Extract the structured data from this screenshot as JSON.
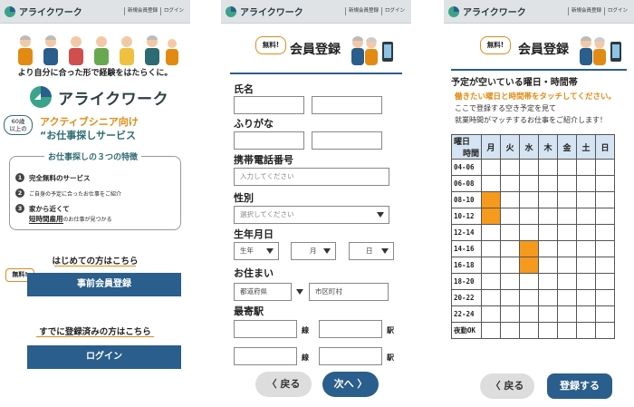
{
  "brand": {
    "name": "アライクワーク",
    "accent": "#2a5e8c",
    "orange": "#e38a12",
    "teal": "#2d6b73"
  },
  "header": {
    "register": "新規会員登録",
    "login": "ログイン"
  },
  "screen1": {
    "tagline": "より自分に合った形で経験をはたらくに。",
    "brand_big": "アライクワーク",
    "age_badge": [
      "60歳",
      "以上の"
    ],
    "subtitle_1": "アクティブシニア向け",
    "subtitle_2": "“お仕事探しサービス",
    "features_title": "お仕事探しの３つの特徴",
    "feature_1": "完全無料のサービス",
    "feature_2a": "ご自身の予定に合った",
    "feature_2b": "お仕事をご紹介",
    "feature_3a": "家から近くて",
    "feature_3b": "短時間雇用",
    "feature_3c": "のお仕事が見つかる",
    "first_time": "はじめての方はこちら",
    "free_badge": "無料!",
    "pre_register": "事前会員登録",
    "already": "すでに登録済みの方はこちら",
    "login_button": "ログイン"
  },
  "screen2": {
    "free": "無料!",
    "title": "会員登録",
    "name_label": "氏名",
    "furigana_label": "ふりがな",
    "phone_label": "携帯電話番号",
    "phone_placeholder": "入力してください",
    "gender_label": "性別",
    "gender_placeholder": "選択してください",
    "birth_label": "生年月日",
    "year": "生年",
    "month": "月",
    "day": "日",
    "address_label": "お住まい",
    "pref": "都道府県",
    "city": "市区町村",
    "station_label": "最寄駅",
    "line": "線",
    "station": "駅",
    "back": "戻る",
    "next": "次へ"
  },
  "screen3": {
    "free": "無料!",
    "title": "会員登録",
    "heading": "予定が空いている曜日・時間帯",
    "instruction": "働きたい曜日と時間帯をタッチしてください。",
    "guide_1": "ここで登録する空き予定を見て",
    "guide_2": "就業時間がマッチするお仕事をご紹介します！",
    "corner_day": "曜日",
    "corner_time": "時間",
    "days": [
      "月",
      "火",
      "水",
      "木",
      "金",
      "土",
      "日"
    ],
    "slots": [
      "04-06",
      "06-08",
      "08-10",
      "10-12",
      "12-14",
      "14-16",
      "16-18",
      "18-20",
      "20-22",
      "22-24",
      "夜勤OK"
    ],
    "selected": [
      [
        2,
        0
      ],
      [
        3,
        0
      ],
      [
        5,
        2
      ],
      [
        6,
        2
      ]
    ],
    "selected_color": "#f59a1d",
    "back": "戻る",
    "submit": "登録する"
  }
}
